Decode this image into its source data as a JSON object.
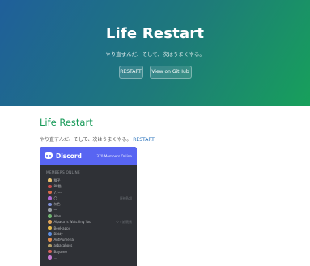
{
  "hero": {
    "title": "Life Restart",
    "subtitle": "やり直すんだ、そして、次はうまくやる。",
    "restart_label": "RESTART",
    "github_label": "View on GitHub"
  },
  "content": {
    "title": "Life Restart",
    "tagline": "やり直すんだ、そして、次はうまくやる。",
    "restart_link": "RESTART"
  },
  "discord": {
    "brand": "Discord",
    "online": "370 Members Online",
    "members_label": "MEMBERS ONLINE",
    "members": [
      {
        "name": "猫子",
        "color": "#e8c170"
      },
      {
        "name": "88猫",
        "color": "#c94b4b"
      },
      {
        "name": "77---",
        "color": "#d86a4a"
      },
      {
        "name": "〇",
        "color": "#b06bd6",
        "game": "原神Roll"
      },
      {
        "name": "灰色",
        "color": "#7d8fd6"
      },
      {
        "name": "一",
        "color": "#9aa0a6"
      },
      {
        "name": "Alan",
        "color": "#6fb36f"
      },
      {
        "name": "Alpaca Is Watching You",
        "color": "#d9a15a",
        "game": "ウマ娘競馬"
      },
      {
        "name": "BeeHappy",
        "color": "#e5b84a"
      },
      {
        "name": "Biddy",
        "color": "#5d8ee0"
      },
      {
        "name": "AntPlumeria",
        "color": "#e08a4a"
      },
      {
        "name": "arbacahoss",
        "color": "#b5a06a"
      },
      {
        "name": "Bayamo",
        "color": "#d4625b"
      },
      {
        "name": "…",
        "color": "#c37ad0"
      }
    ]
  }
}
